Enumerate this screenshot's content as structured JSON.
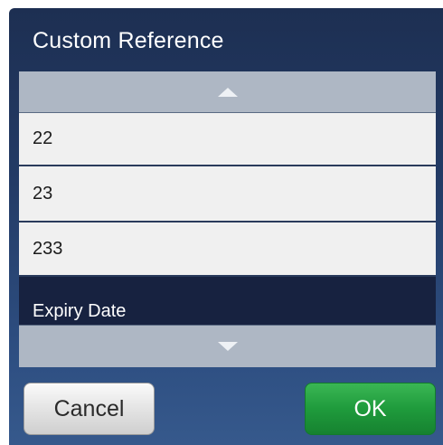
{
  "dialog": {
    "title": "Custom Reference",
    "scroll_up_icon": "triangle-up-icon",
    "scroll_down_icon": "triangle-down-icon",
    "items": [
      {
        "label": "22"
      },
      {
        "label": "23"
      },
      {
        "label": "233"
      },
      {
        "label": "Expiry Date",
        "selected": true
      }
    ],
    "cancel_label": "Cancel",
    "ok_label": "OK",
    "colors": {
      "header_bg": "#1d2f52",
      "selected_bg": "#172240",
      "ok_green": "#1f9b3c"
    }
  }
}
